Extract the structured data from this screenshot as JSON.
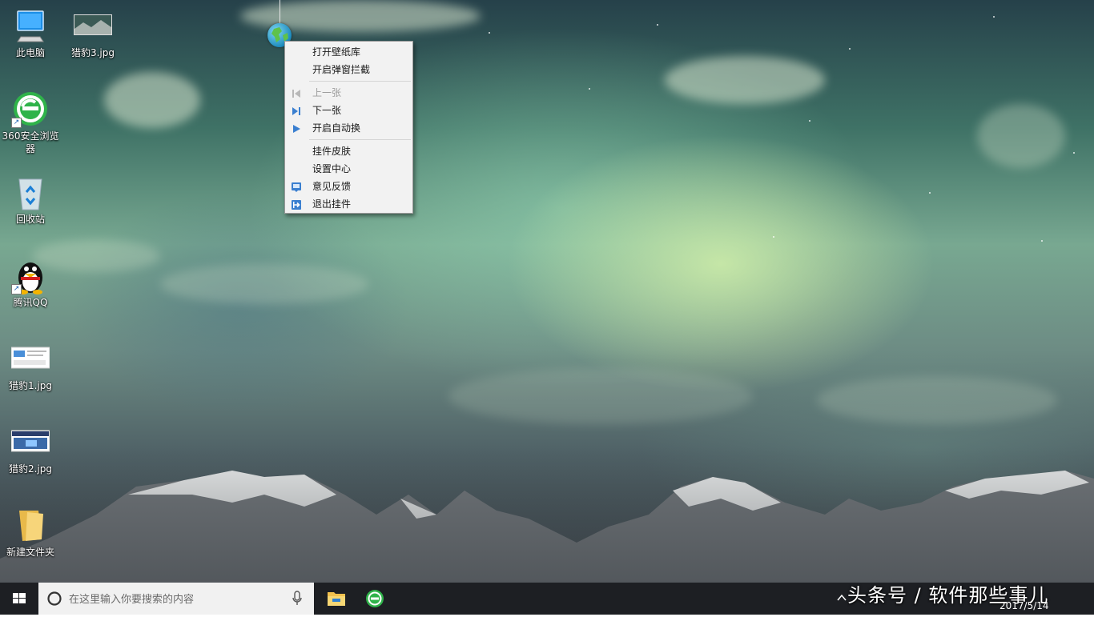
{
  "desktop": {
    "icons": [
      {
        "name": "此电脑"
      },
      {
        "name": "猎豹3.jpg"
      },
      {
        "name": "360安全浏览器"
      },
      {
        "name": "回收站"
      },
      {
        "name": "腾讯QQ"
      },
      {
        "name": "猎豹1.jpg"
      },
      {
        "name": "猎豹2.jpg"
      },
      {
        "name": "新建文件夹"
      }
    ]
  },
  "widget": {
    "icon": "globe-icon"
  },
  "context_menu": {
    "items": [
      {
        "label": "打开壁纸库",
        "enabled": true
      },
      {
        "label": "开启弹窗拦截",
        "enabled": true
      },
      {
        "label": "上一张",
        "enabled": false,
        "icon": "previous-icon"
      },
      {
        "label": "下一张",
        "enabled": true,
        "icon": "next-icon"
      },
      {
        "label": "开启自动换",
        "enabled": true,
        "icon": "play-icon"
      },
      {
        "label": "挂件皮肤",
        "enabled": true
      },
      {
        "label": "设置中心",
        "enabled": true
      },
      {
        "label": "意见反馈",
        "enabled": true,
        "icon": "feedback-icon"
      },
      {
        "label": "退出挂件",
        "enabled": true,
        "icon": "exit-icon"
      }
    ]
  },
  "taskbar": {
    "search_placeholder": "在这里输入你要搜索的内容",
    "pinned": [
      "file-explorer",
      "360-browser"
    ],
    "tray_date": "2017/5/14"
  },
  "watermark": "头条号 / 软件那些事儿",
  "colors": {
    "menu_bg": "#f2f2f2",
    "accent": "#3a7fd0",
    "taskbar": "#14161a"
  }
}
